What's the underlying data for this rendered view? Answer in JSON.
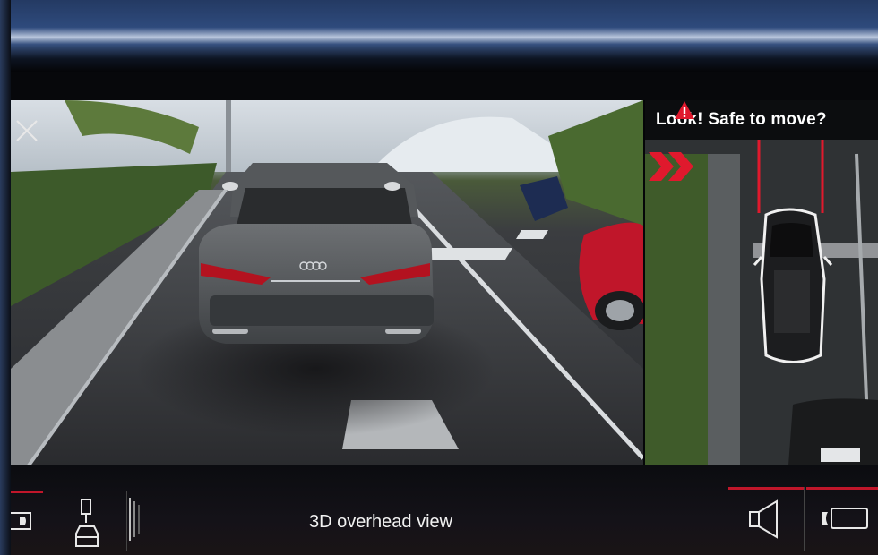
{
  "warning": {
    "text": "Look! Safe to move?",
    "icon": "warning-triangle-icon",
    "color": "#e0192d"
  },
  "top_view": {
    "direction_icon": "double-chevron-right-icon",
    "guide_line_color": "#e0192d"
  },
  "main_view": {
    "close_icon": "close-icon"
  },
  "bottom_bar": {
    "view_label": "3D overhead view",
    "accent_color": "#c0162a",
    "left_buttons": [
      {
        "icon": "front-camera-icon"
      },
      {
        "icon": "view-selector-car-icon"
      }
    ],
    "right_buttons": [
      {
        "icon": "speaker-icon"
      },
      {
        "icon": "rear-camera-icon"
      }
    ]
  }
}
